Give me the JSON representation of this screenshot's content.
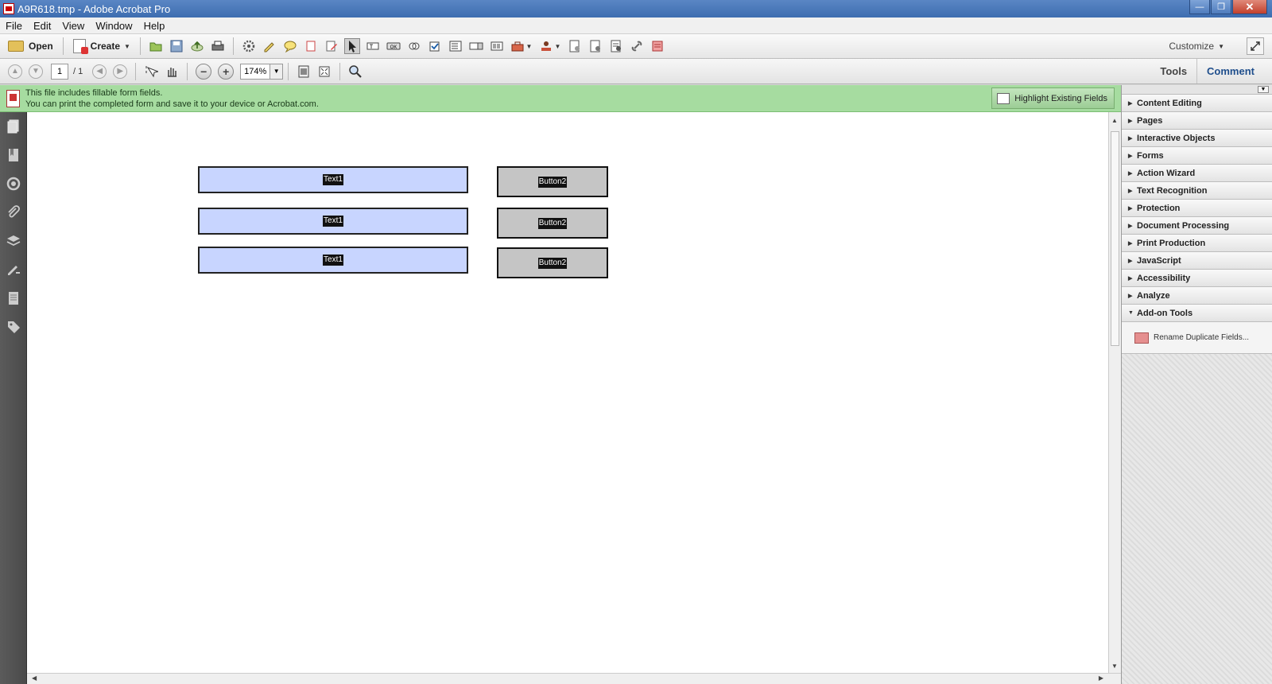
{
  "window": {
    "title": "A9R618.tmp - Adobe Acrobat Pro"
  },
  "menu": [
    "File",
    "Edit",
    "View",
    "Window",
    "Help"
  ],
  "toolbar": {
    "open_label": "Open",
    "create_label": "Create",
    "customize_label": "Customize"
  },
  "nav": {
    "page_current": "1",
    "page_total": "/ 1",
    "zoom": "174%",
    "tools_tab": "Tools",
    "comment_tab": "Comment"
  },
  "notification": {
    "line1": "This file includes fillable form fields.",
    "line2": "You can print the completed form and save it to your device or Acrobat.com.",
    "highlight_button": "Highlight Existing Fields",
    "bar_color": "#a6dca0"
  },
  "form": {
    "text_fields": [
      "Text1",
      "Text1",
      "Text1"
    ],
    "buttons": [
      "Button2",
      "Button2",
      "Button2"
    ],
    "text_field_color": "#c8d5ff",
    "button_color": "#c5c5c5"
  },
  "panel": {
    "sections": [
      "Content Editing",
      "Pages",
      "Interactive Objects",
      "Forms",
      "Action Wizard",
      "Text Recognition",
      "Protection",
      "Document Processing",
      "Print Production",
      "JavaScript",
      "Accessibility",
      "Analyze"
    ],
    "expanded_section": "Add-on Tools",
    "addon_item": "Rename Duplicate Fields..."
  },
  "icons": {
    "left_nav": [
      "pages-icon",
      "bookmark-icon",
      "signature-icon",
      "attachment-icon",
      "layers-icon",
      "model-tree-icon",
      "content-icon",
      "tags-icon"
    ]
  }
}
